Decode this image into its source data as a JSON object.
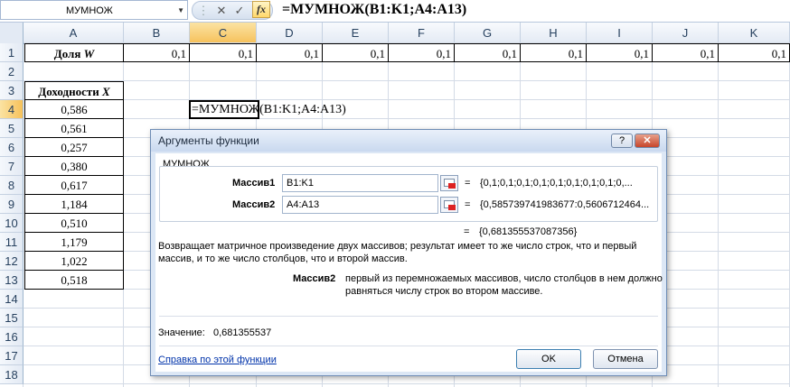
{
  "formula_bar": {
    "name_box": "МУМНОЖ",
    "cancel_icon": "close-icon",
    "enter_icon": "check-icon",
    "fx_label": "fx",
    "formula": "=МУМНОЖ(B1:K1;A4:A13)"
  },
  "columns": [
    "A",
    "B",
    "C",
    "D",
    "E",
    "F",
    "G",
    "H",
    "I",
    "J",
    "K"
  ],
  "rows": [
    "1",
    "2",
    "3",
    "4",
    "5",
    "6",
    "7",
    "8",
    "9",
    "10",
    "11",
    "12",
    "13",
    "14",
    "15",
    "16",
    "17",
    "18"
  ],
  "sheet": {
    "a1_text": "Доля ",
    "a1_var": "W",
    "weights": [
      "0,1",
      "0,1",
      "0,1",
      "0,1",
      "0,1",
      "0,1",
      "0,1",
      "0,1",
      "0,1",
      "0,1"
    ],
    "a3_text": "Доходности ",
    "a3_var": "X",
    "returns": [
      "0,586",
      "0,561",
      "0,257",
      "0,380",
      "0,617",
      "1,184",
      "0,510",
      "1,179",
      "1,022",
      "0,518"
    ],
    "c4_edit": "=МУМНОЖ(B1:K1;A4:A13)"
  },
  "dialog": {
    "title": "Аргументы функции",
    "help_btn": "?",
    "close_btn": "✕",
    "function_name": "МУМНОЖ",
    "arg1_label": "Массив1",
    "arg1_value": "B1:K1",
    "arg1_eq": "=",
    "arg1_result": "{0,1;0,1;0,1;0,1;0,1;0,1;0,1;0,1;0,...",
    "arg2_label": "Массив2",
    "arg2_value": "A4:A13",
    "arg2_eq": "=",
    "arg2_result": "{0,585739741983677:0,5606712464...",
    "result_eq": "=",
    "result_value": "{0,681355537087356}",
    "description_line1": "Возвращает матричное произведение двух массивов; результат имеет то же число строк, что и первый",
    "description_line2": "массив, и то же число столбцов, что и второй массив.",
    "arg_help_name": "Массив2",
    "arg_help_line1": "первый из перемножаемых массивов, число столбцов в нем должно",
    "arg_help_line2": "равняться числу строк во втором массиве.",
    "value_label": "Значение:",
    "value": "0,681355537",
    "help_link": "Справка по этой функции",
    "ok": "OK",
    "cancel": "Отмена"
  },
  "colors": {
    "selected_header": "#f6c15a",
    "header_bg": "#e3eaf4",
    "dialog_bg": "#dce7f5",
    "link": "#0033aa"
  }
}
